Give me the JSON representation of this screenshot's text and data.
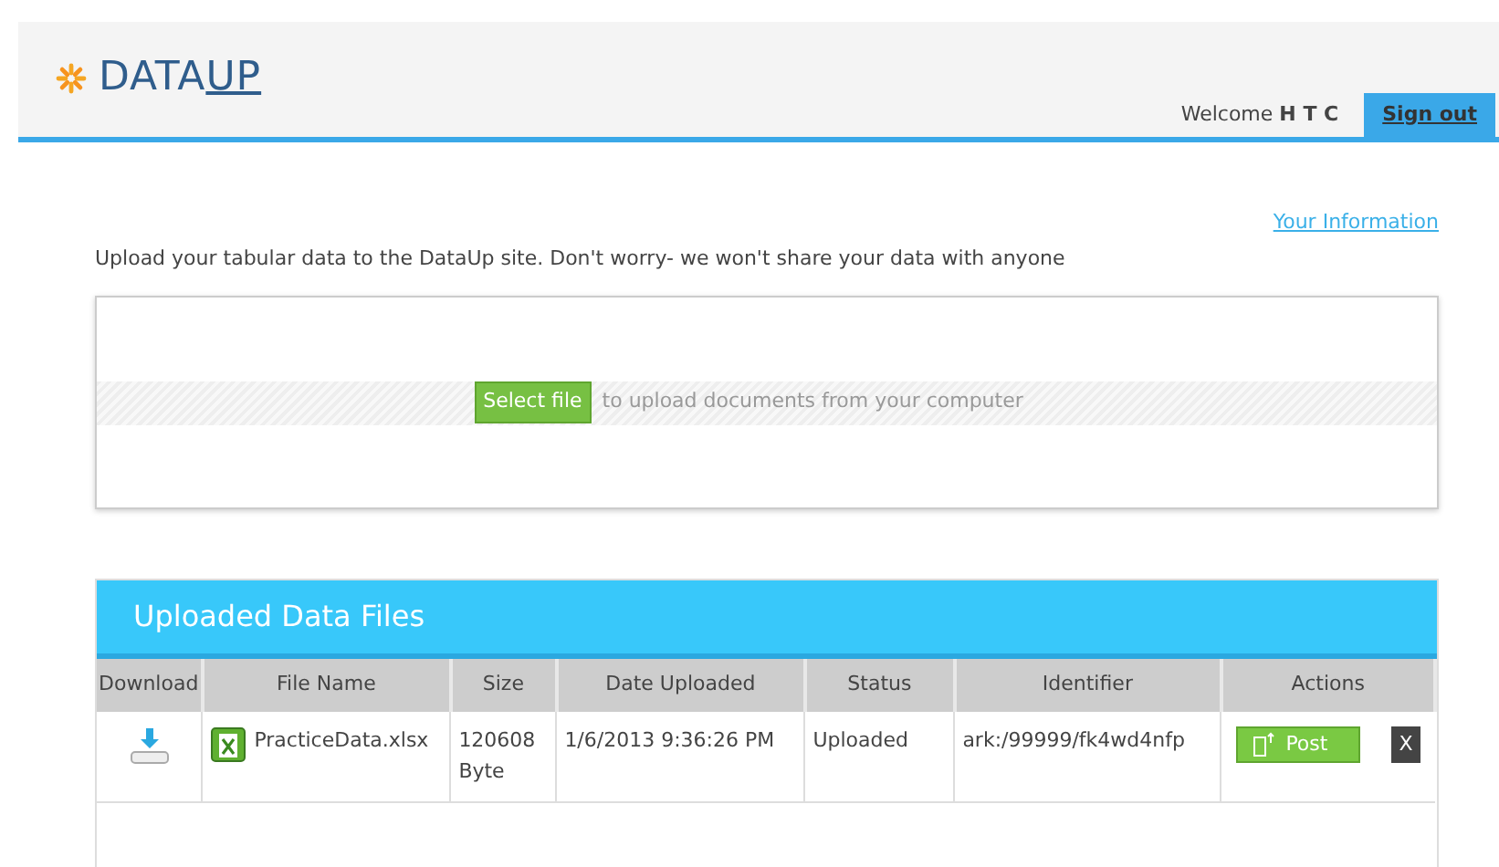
{
  "header": {
    "logo_text": "DATA",
    "logo_accent": "UP",
    "welcome": "Welcome",
    "user": "H T C",
    "sign_out": "Sign out"
  },
  "info_link": "Your Information",
  "intro": "Upload your tabular data to the DataUp site. Don't worry- we won't share your data with anyone",
  "upload": {
    "button": "Select file",
    "hint": "to upload documents from your computer"
  },
  "files": {
    "title": "Uploaded Data Files",
    "columns": [
      "Download",
      "File Name",
      "Size",
      "Date Uploaded",
      "Status",
      "Identifier",
      "Actions"
    ],
    "rows": [
      {
        "file_name": "PracticeData.xlsx",
        "size": "120608 Byte",
        "date": "1/6/2013 9:36:26 PM",
        "status": "Uploaded",
        "identifier": "ark:/99999/fk4wd4nfp",
        "post": "Post",
        "delete": "X"
      }
    ]
  }
}
